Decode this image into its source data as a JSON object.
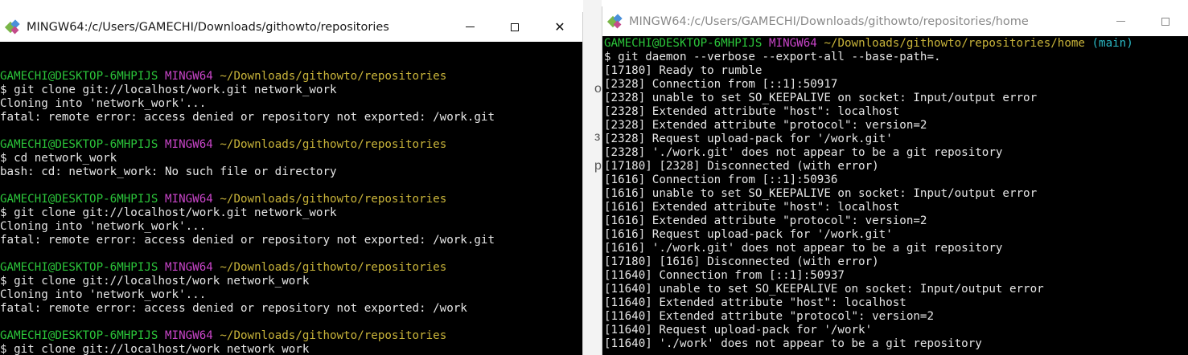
{
  "left_window": {
    "title": "MINGW64:/c/Users/GAMECHI/Downloads/githowto/repositories",
    "lines": [
      {
        "type": "blank",
        "text": ""
      },
      {
        "type": "prompt",
        "user": "GAMECHI@DESKTOP-6MHPIJS",
        "system": "MINGW64",
        "path": "~/Downloads/githowto/repositories"
      },
      {
        "type": "text",
        "text": "$ git clone git://localhost/work.git network_work"
      },
      {
        "type": "text",
        "text": "Cloning into 'network_work'..."
      },
      {
        "type": "text",
        "text": "fatal: remote error: access denied or repository not exported: /work.git"
      },
      {
        "type": "blank",
        "text": ""
      },
      {
        "type": "prompt",
        "user": "GAMECHI@DESKTOP-6MHPIJS",
        "system": "MINGW64",
        "path": "~/Downloads/githowto/repositories"
      },
      {
        "type": "text",
        "text": "$ cd network_work"
      },
      {
        "type": "text",
        "text": "bash: cd: network_work: No such file or directory"
      },
      {
        "type": "blank",
        "text": ""
      },
      {
        "type": "prompt",
        "user": "GAMECHI@DESKTOP-6MHPIJS",
        "system": "MINGW64",
        "path": "~/Downloads/githowto/repositories"
      },
      {
        "type": "text",
        "text": "$ git clone git://localhost/work.git network_work"
      },
      {
        "type": "text",
        "text": "Cloning into 'network_work'..."
      },
      {
        "type": "text",
        "text": "fatal: remote error: access denied or repository not exported: /work.git"
      },
      {
        "type": "blank",
        "text": ""
      },
      {
        "type": "prompt",
        "user": "GAMECHI@DESKTOP-6MHPIJS",
        "system": "MINGW64",
        "path": "~/Downloads/githowto/repositories"
      },
      {
        "type": "text",
        "text": "$ git clone git://localhost/work network_work"
      },
      {
        "type": "text",
        "text": "Cloning into 'network_work'..."
      },
      {
        "type": "text",
        "text": "fatal: remote error: access denied or repository not exported: /work"
      },
      {
        "type": "blank",
        "text": ""
      },
      {
        "type": "prompt",
        "user": "GAMECHI@DESKTOP-6MHPIJS",
        "system": "MINGW64",
        "path": "~/Downloads/githowto/repositories"
      },
      {
        "type": "text",
        "text": "$ git clone git://localhost/work network_work"
      }
    ]
  },
  "right_window": {
    "title": "MINGW64:/c/Users/GAMECHI/Downloads/githowto/repositories/home",
    "lines": [
      {
        "type": "prompt",
        "user": "GAMECHI@DESKTOP-6MHPIJS",
        "system": "MINGW64",
        "path": "~/Downloads/githowto/repositories/home",
        "branch": "(main)"
      },
      {
        "type": "text",
        "text": "$ git daemon --verbose --export-all --base-path=."
      },
      {
        "type": "text",
        "text": "[17180] Ready to rumble"
      },
      {
        "type": "text",
        "text": "[2328] Connection from [::1]:50917"
      },
      {
        "type": "text",
        "text": "[2328] unable to set SO_KEEPALIVE on socket: Input/output error"
      },
      {
        "type": "text",
        "text": "[2328] Extended attribute \"host\": localhost"
      },
      {
        "type": "text",
        "text": "[2328] Extended attribute \"protocol\": version=2"
      },
      {
        "type": "text",
        "text": "[2328] Request upload-pack for '/work.git'"
      },
      {
        "type": "text",
        "text": "[2328] './work.git' does not appear to be a git repository"
      },
      {
        "type": "text",
        "text": "[17180] [2328] Disconnected (with error)"
      },
      {
        "type": "text",
        "text": "[1616] Connection from [::1]:50936"
      },
      {
        "type": "text",
        "text": "[1616] unable to set SO_KEEPALIVE on socket: Input/output error"
      },
      {
        "type": "text",
        "text": "[1616] Extended attribute \"host\": localhost"
      },
      {
        "type": "text",
        "text": "[1616] Extended attribute \"protocol\": version=2"
      },
      {
        "type": "text",
        "text": "[1616] Request upload-pack for '/work.git'"
      },
      {
        "type": "text",
        "text": "[1616] './work.git' does not appear to be a git repository"
      },
      {
        "type": "text",
        "text": "[17180] [1616] Disconnected (with error)"
      },
      {
        "type": "text",
        "text": "[11640] Connection from [::1]:50937"
      },
      {
        "type": "text",
        "text": "[11640] unable to set SO_KEEPALIVE on socket: Input/output error"
      },
      {
        "type": "text",
        "text": "[11640] Extended attribute \"host\": localhost"
      },
      {
        "type": "text",
        "text": "[11640] Extended attribute \"protocol\": version=2"
      },
      {
        "type": "text",
        "text": "[11640] Request upload-pack for '/work'"
      },
      {
        "type": "text",
        "text": "[11640] './work' does not appear to be a git repository"
      }
    ]
  },
  "background_glyphs": [
    "o",
    "з",
    "p"
  ],
  "colors": {
    "terminal_bg": "#000000",
    "terminal_fg": "#e6e6e6",
    "user": "#2bc53a",
    "system": "#c945c9",
    "path": "#c9b43a",
    "branch": "#2ab8c4"
  },
  "icons": {
    "app": "git-bash-icon",
    "minimize": "minimize-icon",
    "maximize": "maximize-icon",
    "close": "close-icon"
  }
}
